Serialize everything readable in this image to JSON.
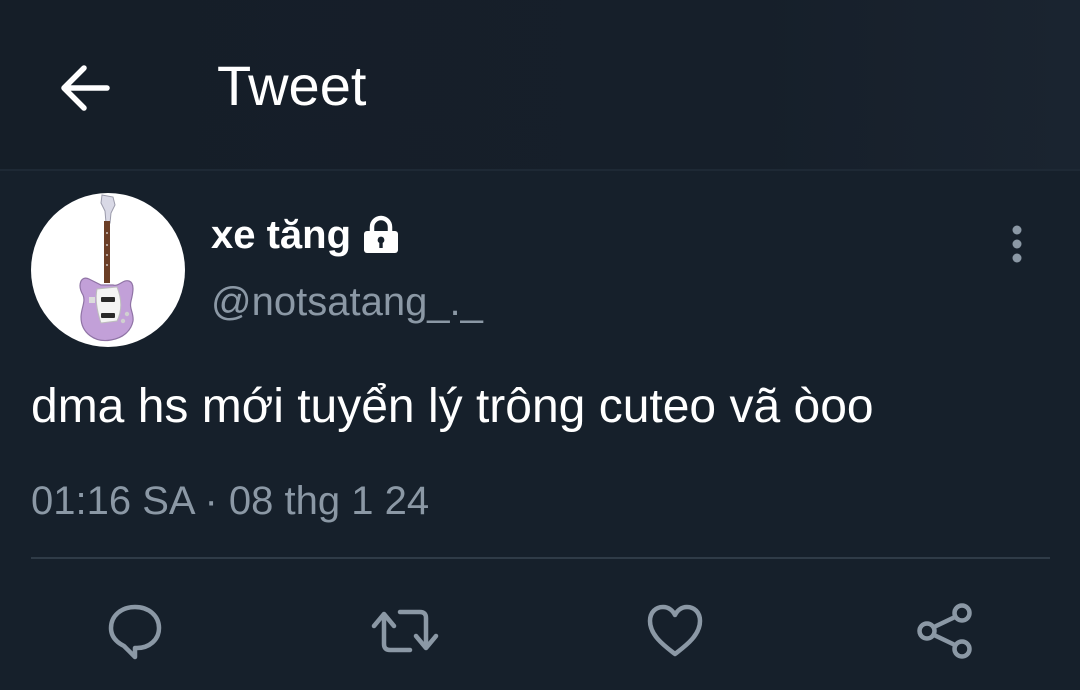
{
  "header": {
    "title": "Tweet",
    "back_icon": "arrow-left-icon"
  },
  "tweet": {
    "display_name": "xe tăng",
    "protected_icon": "lock-icon",
    "handle": "@notsatang_._",
    "text": "dma hs mới tuyển lý trông cuteo vã òoo",
    "timestamp": "01:16 SA · 08 thg 1 24",
    "avatar_icon": "guitar-icon"
  },
  "actions": [
    {
      "icon": "reply-icon"
    },
    {
      "icon": "retweet-icon"
    },
    {
      "icon": "like-icon"
    },
    {
      "icon": "share-icon"
    }
  ],
  "colors": {
    "background": "#16202b",
    "text_primary": "#ffffff",
    "text_secondary": "#8b98a5",
    "divider": "#2f3b47",
    "guitar_body": "#c2a0d8"
  }
}
